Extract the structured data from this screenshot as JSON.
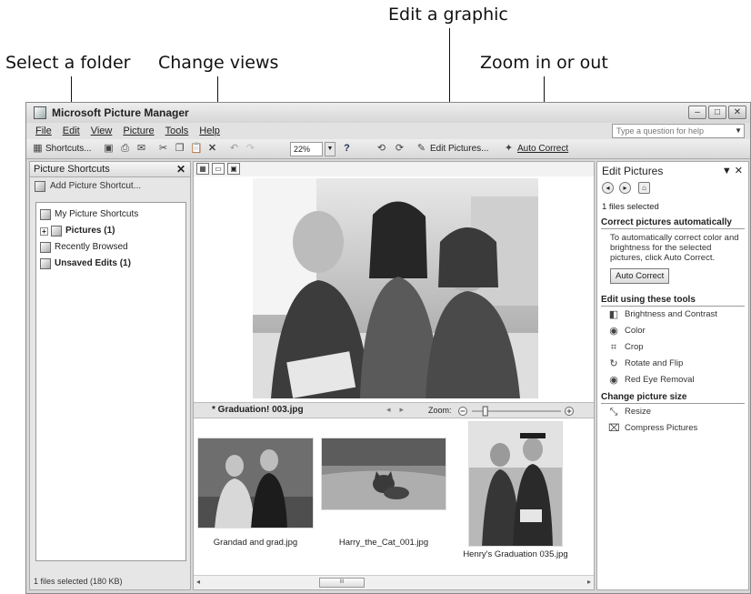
{
  "callouts": {
    "edit_graphic": "Edit a graphic",
    "select_folder": "Select a folder",
    "change_views": "Change views",
    "zoom": "Zoom in or out"
  },
  "window": {
    "title": "Microsoft Picture Manager",
    "help_placeholder": "Type a question for help"
  },
  "menu": [
    "File",
    "Edit",
    "View",
    "Picture",
    "Tools",
    "Help"
  ],
  "toolbar": {
    "shortcuts": "Shortcuts...",
    "zoom_value": "22%",
    "edit_pictures": "Edit Pictures...",
    "auto_correct": "Auto Correct"
  },
  "left_pane": {
    "title": "Picture Shortcuts",
    "add_shortcut": "Add Picture Shortcut...",
    "tree": [
      {
        "label": "My Picture Shortcuts",
        "bold": false
      },
      {
        "label": "Pictures (1)",
        "bold": true
      },
      {
        "label": "Recently Browsed",
        "bold": false
      },
      {
        "label": "Unsaved Edits (1)",
        "bold": true
      }
    ],
    "status": "1 files selected (180 KB)"
  },
  "center": {
    "filename": "* Graduation! 003.jpg",
    "zoom_label": "Zoom:",
    "zoom_level": 0.15,
    "thumbnails": [
      {
        "caption": "Grandad and grad.jpg"
      },
      {
        "caption": "Harry_the_Cat_001.jpg"
      },
      {
        "caption": "Henry's Graduation 035.jpg"
      }
    ]
  },
  "right_pane": {
    "title": "Edit Pictures",
    "selected": "1 files selected",
    "section_auto": "Correct pictures automatically",
    "auto_desc": "To automatically correct color and brightness for the selected pictures, click Auto Correct.",
    "auto_button": "Auto Correct",
    "section_tools": "Edit using these tools",
    "tools": [
      "Brightness and Contrast",
      "Color",
      "Crop",
      "Rotate and Flip",
      "Red Eye Removal"
    ],
    "section_size": "Change picture size",
    "size_tools": [
      "Resize",
      "Compress Pictures"
    ]
  }
}
